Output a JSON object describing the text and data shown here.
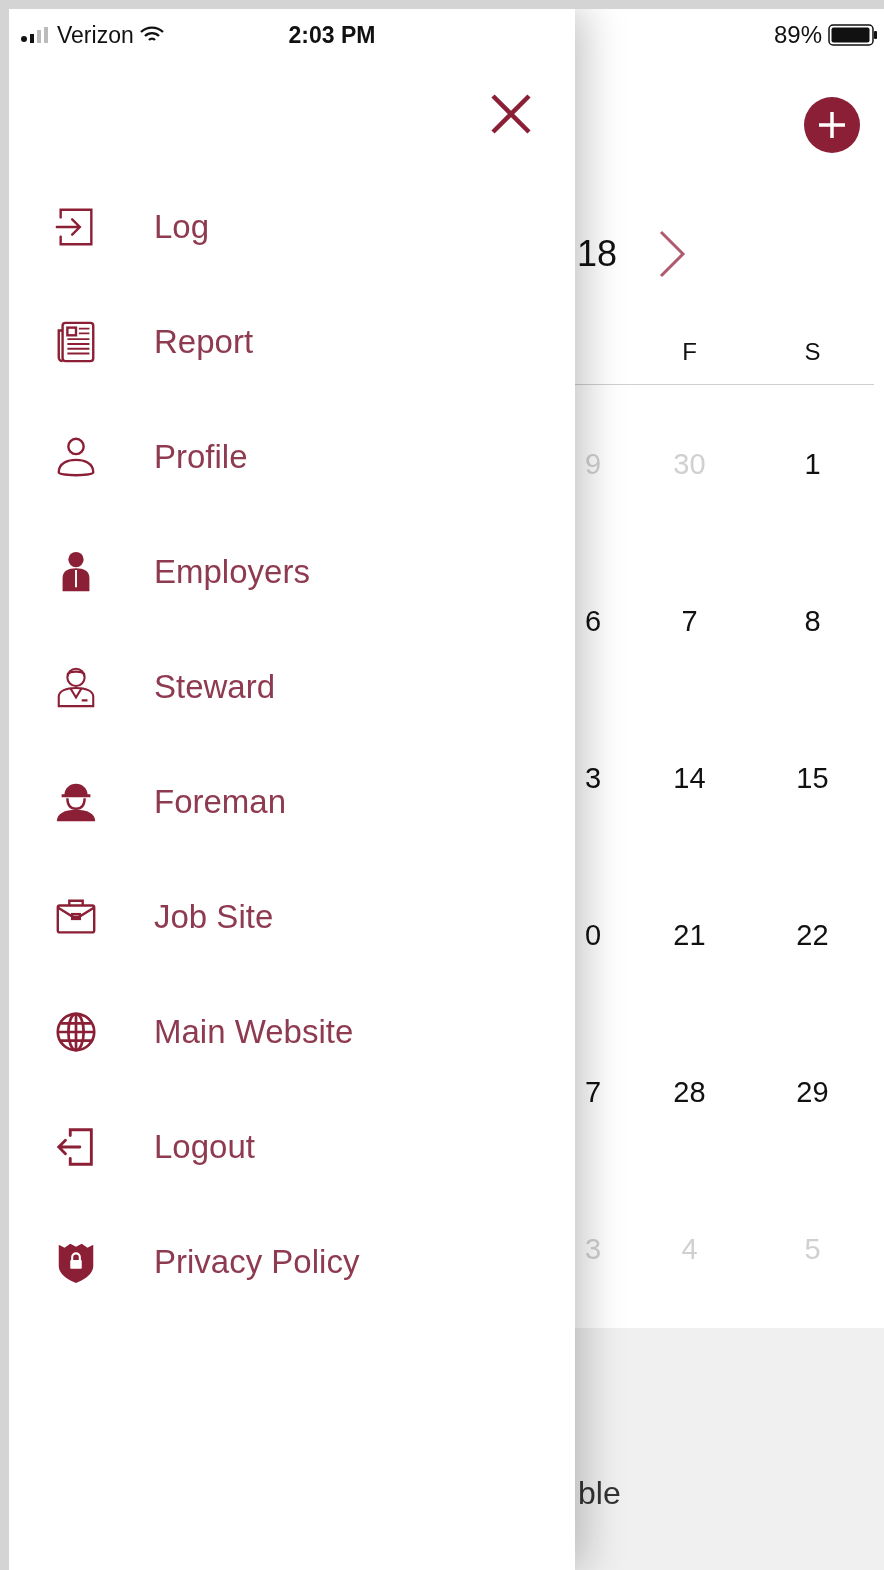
{
  "status_bar": {
    "carrier": "Verizon",
    "time": "2:03 PM",
    "battery": "89%"
  },
  "menu": [
    {
      "label": "Log",
      "kind": "login"
    },
    {
      "label": "Report",
      "kind": "newspaper"
    },
    {
      "label": "Profile",
      "kind": "person"
    },
    {
      "label": "Employers",
      "kind": "tie"
    },
    {
      "label": "Steward",
      "kind": "badge"
    },
    {
      "label": "Foreman",
      "kind": "helmet"
    },
    {
      "label": "Job Site",
      "kind": "briefcase"
    },
    {
      "label": "Main Website",
      "kind": "globe"
    },
    {
      "label": "Logout",
      "kind": "logout"
    },
    {
      "label": "Privacy Policy",
      "kind": "shield"
    }
  ],
  "calendar": {
    "month": "18",
    "weekdays": [
      "F",
      "S"
    ],
    "weeks": [
      [
        {
          "day": "9",
          "muted": true
        },
        {
          "day": "30",
          "muted": true
        },
        {
          "day": "1",
          "muted": false
        }
      ],
      [
        {
          "day": "6",
          "muted": false
        },
        {
          "day": "7",
          "muted": false
        },
        {
          "day": "8",
          "muted": false
        }
      ],
      [
        {
          "day": "3",
          "muted": false
        },
        {
          "day": "14",
          "muted": false
        },
        {
          "day": "15",
          "muted": false
        }
      ],
      [
        {
          "day": "0",
          "muted": false
        },
        {
          "day": "21",
          "muted": false
        },
        {
          "day": "22",
          "muted": false
        }
      ],
      [
        {
          "day": "7",
          "muted": false
        },
        {
          "day": "28",
          "muted": false
        },
        {
          "day": "29",
          "muted": false
        }
      ],
      [
        {
          "day": "3",
          "muted": true
        },
        {
          "day": "4",
          "muted": true
        },
        {
          "day": "5",
          "muted": true
        }
      ]
    ]
  },
  "footer": {
    "text": "ble"
  }
}
